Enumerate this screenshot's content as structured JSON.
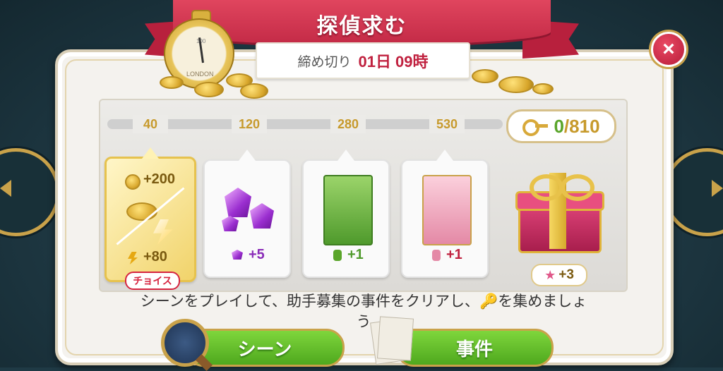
{
  "header": {
    "title": "探偵求む"
  },
  "deadline": {
    "label": "締め切り",
    "value": "01日 09時"
  },
  "watch": {
    "brand": "LONDON",
    "number": "100"
  },
  "progress": {
    "milestones": [
      "40",
      "120",
      "280",
      "530"
    ],
    "current": "0",
    "goal": "/810"
  },
  "rewards": [
    {
      "coins": "+200",
      "energy": "+80",
      "badge": "チョイス"
    },
    {
      "gems": "+5"
    },
    {
      "green_card": "+1"
    },
    {
      "pink_card": "+1"
    },
    {
      "chest_stars": "+3"
    }
  ],
  "description": "シーンをプレイして、助手募集の事件をクリアし、🔑を集めましょう",
  "buttons": {
    "scene": "シーン",
    "case": "事件",
    "close": "×"
  },
  "colors": {
    "ribbon": "#c32a46",
    "gold": "#c79a2c",
    "green": "#5aa52a",
    "button_green": "#5fb428"
  }
}
